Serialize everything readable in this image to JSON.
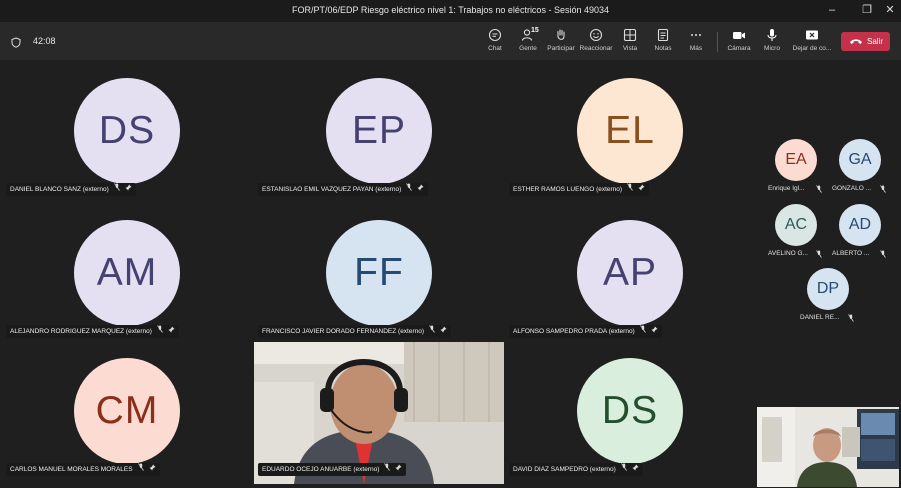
{
  "window": {
    "title": "FOR/PT/06/EDP Riesgo eléctrico nivel 1: Trabajos no eléctricos - Sesión 49034"
  },
  "toolbar": {
    "timer": "42:08",
    "participant_count": "15",
    "buttons": {
      "chat": "Chat",
      "people": "Gente",
      "raise": "Participar",
      "react": "Reaccionar",
      "view": "Vista",
      "notes": "Notas",
      "more": "Más",
      "camera": "Cámara",
      "mic": "Micro",
      "share": "Dejar de co...",
      "leave": "Salir"
    }
  },
  "grid": [
    {
      "initials": "DS",
      "name": "DANIEL BLANCO SANZ (externo)",
      "bg": "#e4e0f2",
      "fg": "#454170"
    },
    {
      "initials": "EP",
      "name": "ESTANISLAO EMIL VAZQUEZ PAYAN (externo)",
      "bg": "#e4e0f2",
      "fg": "#454170"
    },
    {
      "initials": "EL",
      "name": "ESTHER RAMOS LUENGO (externo)",
      "bg": "#fde7d2",
      "fg": "#8a4f1c"
    },
    {
      "initials": "AM",
      "name": "ALEJANDRO RODRIGUEZ MARQUEZ (externo)",
      "bg": "#e4e0f2",
      "fg": "#454170"
    },
    {
      "initials": "FF",
      "name": "FRANCISCO JAVIER DORADO FERNANDEZ (externo)",
      "bg": "#d6e4f2",
      "fg": "#264a72"
    },
    {
      "initials": "AP",
      "name": "ALFONSO SAMPEDRO PRADA (externo)",
      "bg": "#e4e0f2",
      "fg": "#454170"
    },
    {
      "initials": "CM",
      "name": "CARLOS MANUEL MORALES MORALES",
      "bg": "#fcdcd2",
      "fg": "#8a2f19"
    },
    {
      "initials": "",
      "name": "EDUARDO OCEJO ANUARBE (externo)",
      "bg": "",
      "fg": ""
    },
    {
      "initials": "DS",
      "name": "DAVID DIAZ SAMPEDRO (externo)",
      "bg": "#d9eedc",
      "fg": "#244f2f"
    }
  ],
  "side": [
    {
      "initials": "EA",
      "name": "Enrique Igl...",
      "bg": "#fcdcd2",
      "fg": "#8a2f19"
    },
    {
      "initials": "GA",
      "name": "GONZALO ...",
      "bg": "#d6e4f2",
      "fg": "#264a72"
    },
    {
      "initials": "AC",
      "name": "AVELINO G...",
      "bg": "#d9e6e4",
      "fg": "#2c5a55"
    },
    {
      "initials": "AD",
      "name": "ALBERTO ...",
      "bg": "#d6e4f2",
      "fg": "#264a72"
    },
    {
      "initials": "DP",
      "name": "DANIEL RE...",
      "bg": "#d6e4f2",
      "fg": "#264a72"
    }
  ],
  "icons": {
    "mic_off": "mic-off-icon",
    "pin": "pin-icon",
    "shield": "shield-icon",
    "leave": "phone-hangup-icon"
  }
}
